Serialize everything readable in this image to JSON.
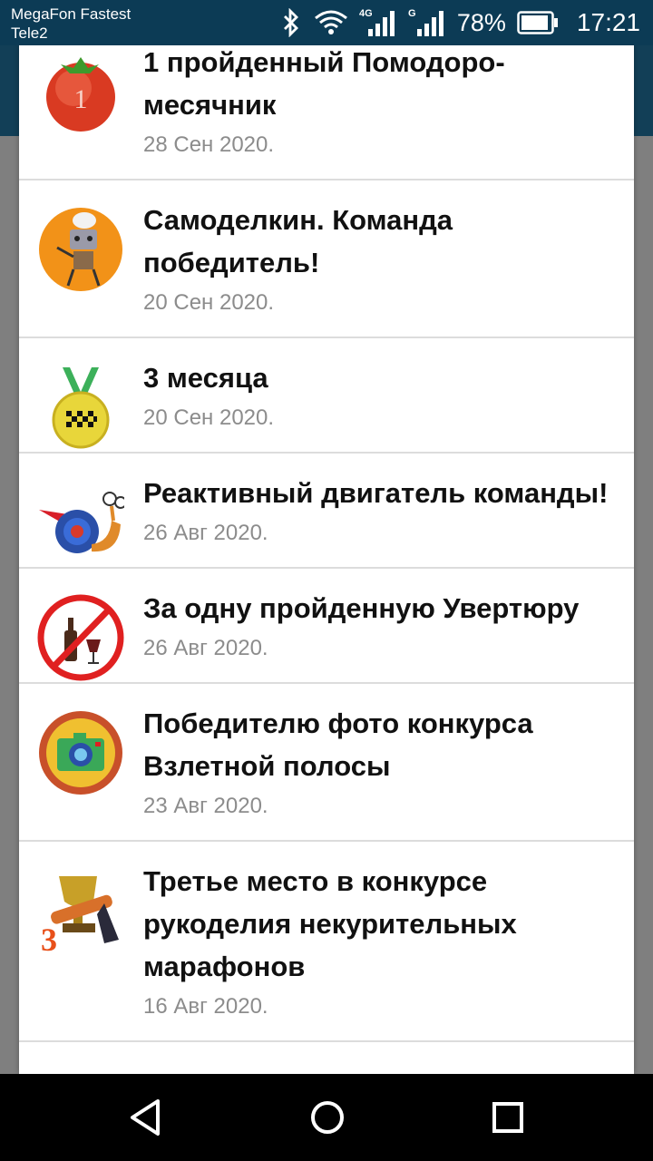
{
  "status_bar": {
    "carrier_primary": "MegaFon Fastest",
    "carrier_secondary": "Tele2",
    "network_4g": "4G",
    "network_g": "G",
    "battery": "78%",
    "time": "17:21",
    "icons": [
      "bluetooth-icon",
      "wifi-icon",
      "signal-4g-icon",
      "signal-g-icon",
      "battery-icon"
    ]
  },
  "achievements": [
    {
      "title": "1 пройденный Помодоро-месячник",
      "date": "28 Сен 2020.",
      "icon": "tomato-badge-icon",
      "badge_text": "1"
    },
    {
      "title": "Самоделкин. Команда победитель!",
      "date": "20 Сен 2020.",
      "icon": "robot-chef-icon"
    },
    {
      "title": "3 месяца",
      "date": "20 Сен 2020.",
      "icon": "checkered-medal-icon"
    },
    {
      "title": "Реактивный двигатель команды!",
      "date": "26 Авг 2020.",
      "icon": "turbo-snail-icon"
    },
    {
      "title": "За одну пройденную Увертюру",
      "date": "26 Авг 2020.",
      "icon": "no-alcohol-icon"
    },
    {
      "title": "Победителю фото конкурса Взлетной полосы",
      "date": "23 Авг 2020.",
      "icon": "camera-badge-icon"
    },
    {
      "title": "Третье место в конкурсе рукоделия некурительных марафонов",
      "date": "16 Авг 2020.",
      "icon": "trophy-third-icon",
      "badge_text": "3"
    }
  ],
  "nav": {
    "icons": [
      "back-icon",
      "home-icon",
      "recents-icon"
    ]
  }
}
